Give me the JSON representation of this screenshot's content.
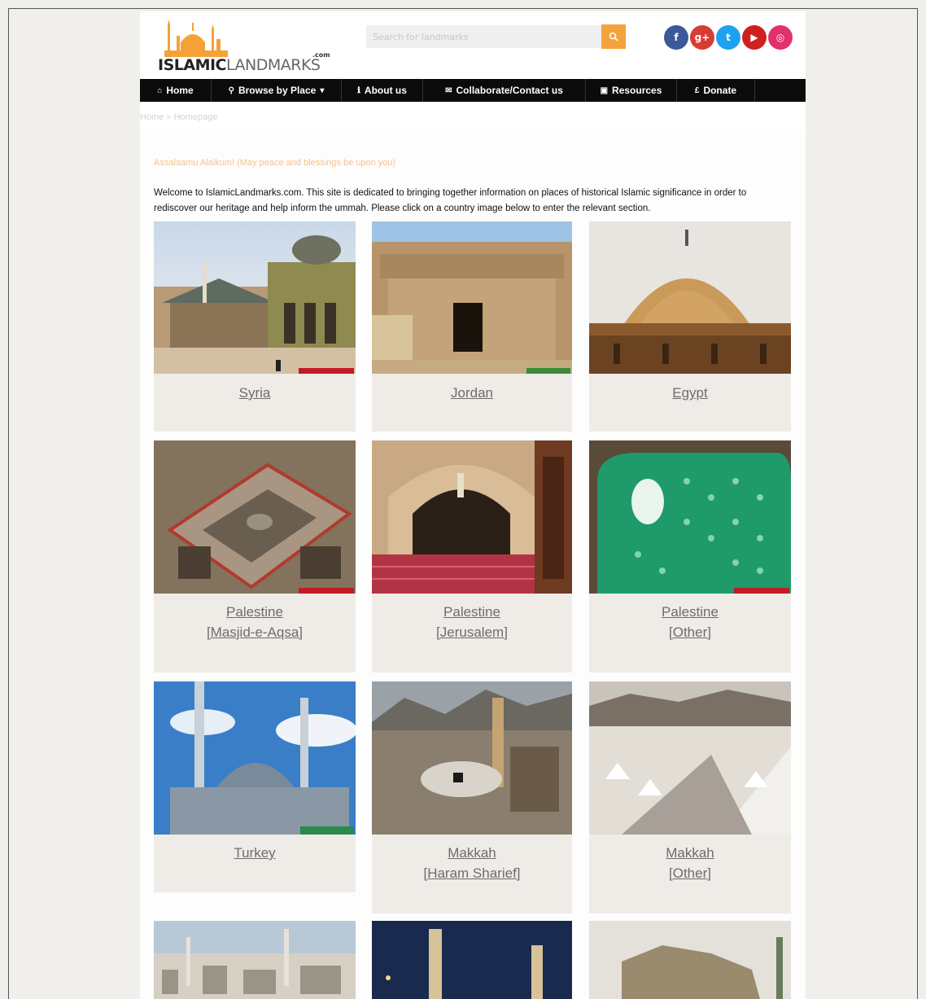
{
  "logo": {
    "part1": "ISLAMIC",
    "part2": "LANDMARKS",
    "suffix": ".com"
  },
  "search": {
    "placeholder": "Search for landmarks",
    "button_icon": "search-icon"
  },
  "socials": [
    {
      "name": "facebook-icon",
      "glyph": "f",
      "color": "#3b5998"
    },
    {
      "name": "google-plus-icon",
      "glyph": "g+",
      "color": "#d73d32"
    },
    {
      "name": "twitter-icon",
      "glyph": "t",
      "color": "#1da1f2"
    },
    {
      "name": "youtube-icon",
      "glyph": "▶",
      "color": "#cd201f"
    },
    {
      "name": "instagram-icon",
      "glyph": "◎",
      "color": "#e1306c"
    }
  ],
  "nav": {
    "home": "Home",
    "browse": "Browse by Place",
    "about": "About us",
    "collab": "Collaborate/Contact us",
    "resources": "Resources",
    "donate": "Donate"
  },
  "breadcrumb": "Home » Homepage",
  "greeting": "Assalaamu Alaikum! (May peace and blessings be upon you)",
  "intro": "Welcome to IslamicLandmarks.com. This site is dedicated to bringing together information on places of historical Islamic significance in order to rediscover our heritage and help inform the ummah. Please click on a country image below to enter the relevant section.",
  "cards": [
    {
      "line1": "Syria",
      "line2": ""
    },
    {
      "line1": "Jordan",
      "line2": ""
    },
    {
      "line1": "Egypt",
      "line2": ""
    },
    {
      "line1": "Palestine",
      "line2": "[Masjid-e-Aqsa]"
    },
    {
      "line1": "Palestine",
      "line2": "[Jerusalem]"
    },
    {
      "line1": "Palestine",
      "line2": "[Other]"
    },
    {
      "line1": "Turkey",
      "line2": ""
    },
    {
      "line1": "Makkah",
      "line2": "[Haram Sharief]"
    },
    {
      "line1": "Makkah",
      "line2": "[Other]"
    }
  ],
  "colors": {
    "accent": "#f6a23c",
    "nav_bg": "#0b0b0b",
    "greeting": "#f4c28b",
    "card_bg": "#efece8"
  }
}
